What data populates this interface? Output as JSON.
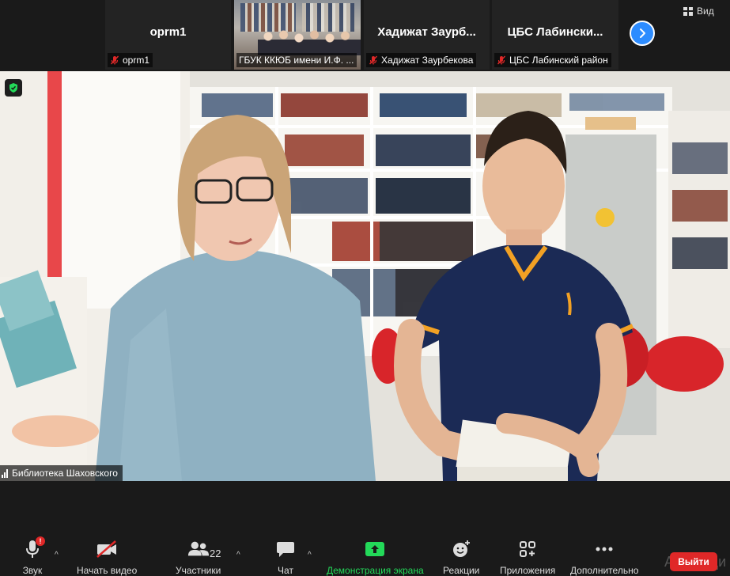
{
  "top_strip": {
    "tiles": [
      {
        "name": "oprm1",
        "label": "oprm1",
        "muted": true,
        "has_video": false
      },
      {
        "name": "",
        "label": "ГБУК ККЮБ имени И.Ф. ...",
        "muted": false,
        "has_video": true
      },
      {
        "name": "Хадижат  Заурб...",
        "label": "Хадижат Заурбекова",
        "muted": true,
        "has_video": false
      },
      {
        "name": "ЦБС  Лабински...",
        "label": "ЦБС Лабинский район",
        "muted": true,
        "has_video": false
      }
    ],
    "view_label": "Вид"
  },
  "main_video": {
    "speaker_label": "Библиотека Шаховского"
  },
  "toolbar": {
    "audio_label": "Звук",
    "video_label": "Начать видео",
    "participants_label": "Участники",
    "participants_count": "22",
    "chat_label": "Чат",
    "share_label": "Демонстрация экрана",
    "reactions_label": "Реакции",
    "apps_label": "Приложения",
    "more_label": "Дополнительно",
    "leave_label": "Выйти",
    "audio_badge": "!",
    "watermark": "Активаци"
  },
  "colors": {
    "accent": "#2d8cff",
    "leave_red": "#e02828",
    "share_green": "#23d959",
    "background": "#1a1a1a"
  }
}
